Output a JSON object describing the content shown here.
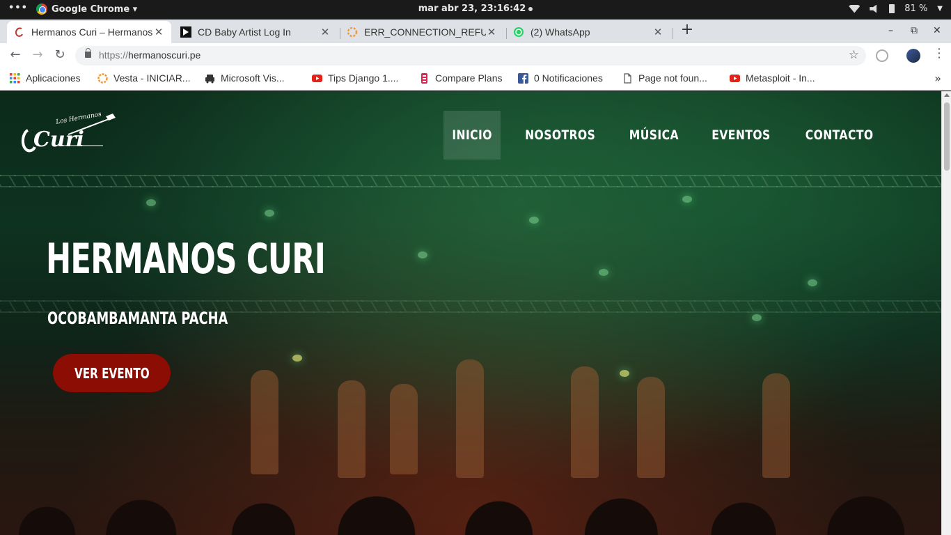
{
  "system_bar": {
    "activities": "•••",
    "app_name": "Google Chrome ▾",
    "clock": "mar abr 23, 23:16:42",
    "battery": "81 %"
  },
  "tabs": [
    {
      "title": "Hermanos Curi – Hermanos",
      "icon": "curi-favicon"
    },
    {
      "title": "CD Baby Artist Log In",
      "icon": "cdbaby-favicon"
    },
    {
      "title": "ERR_CONNECTION_REFUSED",
      "icon": "loading-spinner-icon"
    },
    {
      "title": "(2) WhatsApp",
      "icon": "whatsapp-icon"
    }
  ],
  "window_controls": {
    "minimize": "–",
    "maximize": "⧉",
    "close": "✕"
  },
  "address_bar": {
    "scheme": "https://",
    "host": "hermanoscuri.pe"
  },
  "bookmarks": [
    {
      "label": "Aplicaciones",
      "icon": "apps-grid-icon"
    },
    {
      "label": "Vesta - INICIAR...",
      "icon": "vesta-icon"
    },
    {
      "label": "Microsoft Vis...",
      "icon": "car-icon"
    },
    {
      "label": "Tips Django 1....",
      "icon": "youtube-icon"
    },
    {
      "label": "Compare Plans",
      "icon": "plan-icon"
    },
    {
      "label": "0 Notificaciones",
      "icon": "facebook-icon"
    },
    {
      "label": "Page not foun...",
      "icon": "document-icon"
    },
    {
      "label": "Metasploit - In...",
      "icon": "youtube-icon"
    }
  ],
  "site": {
    "logo_small": "Los Hermanos",
    "logo_main": "Curi",
    "nav": [
      "INICIO",
      "NOSOTROS",
      "MÚSICA",
      "EVENTOS",
      "CONTACTO"
    ],
    "hero_title": "HERMANOS CURI",
    "hero_subtitle": "OCOBAMBAMANTA PACHA",
    "cta_label": "VER EVENTO"
  },
  "colors": {
    "cta": "#8b0d04",
    "youtube": "#e62117",
    "facebook": "#3b5998",
    "whatsapp": "#25d366"
  }
}
